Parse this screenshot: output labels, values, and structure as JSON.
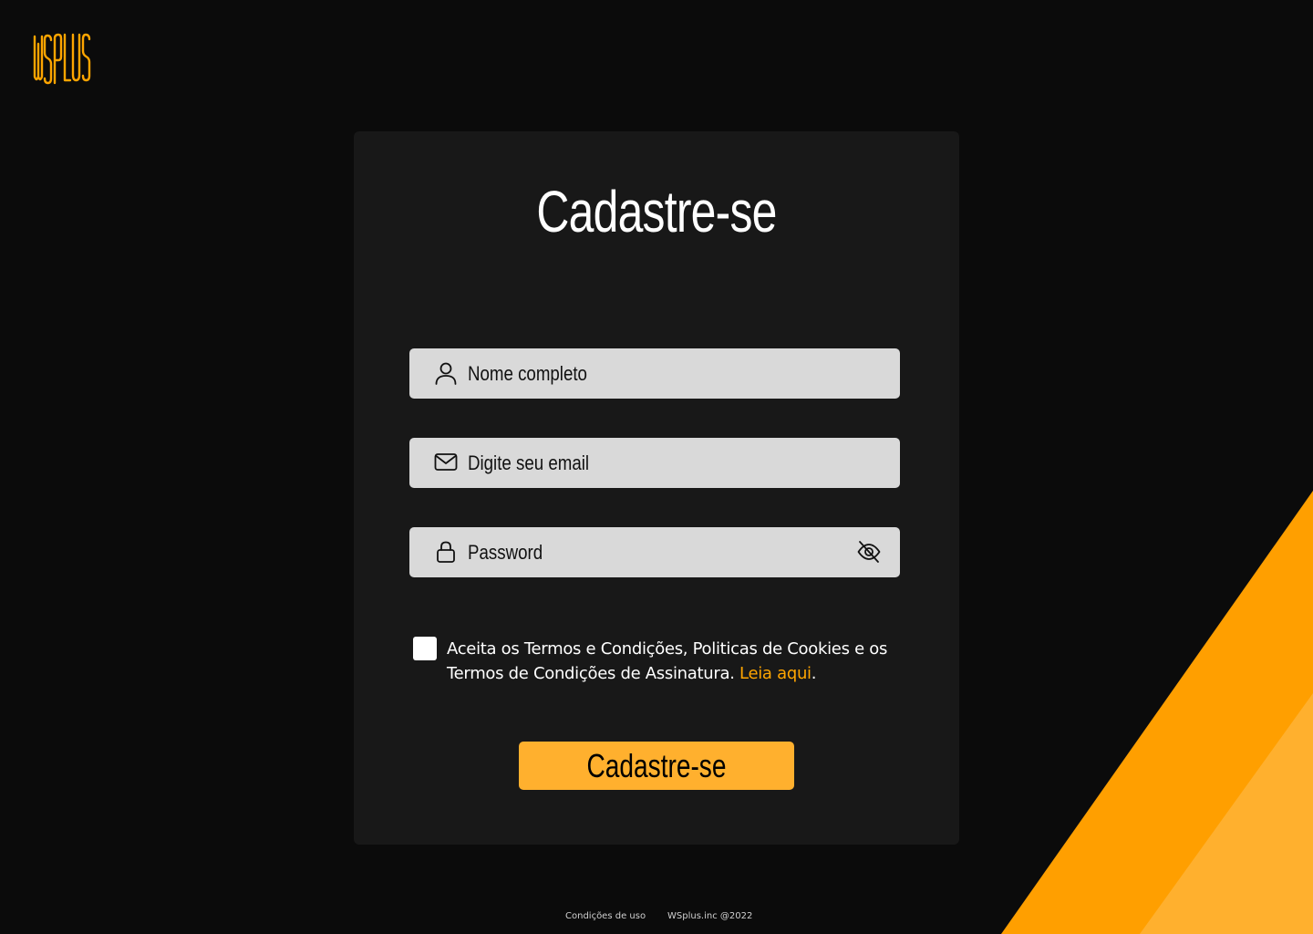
{
  "brand": {
    "logo_text": "WSPLUS",
    "accent_color": "#ffa500",
    "button_color": "#ffb02e",
    "card_color": "#181818",
    "background_color": "#0b0b0b"
  },
  "form": {
    "title": "Cadastre-se",
    "fields": {
      "name": {
        "placeholder": "Nome completo",
        "icon": "user-icon"
      },
      "email": {
        "placeholder": "Digite seu email",
        "icon": "mail-icon"
      },
      "password": {
        "placeholder": "Password",
        "icon": "lock-icon",
        "toggle_icon": "eye-off-icon"
      }
    },
    "terms": {
      "text": "Aceita os Termos e Condições, Politicas de Cookies e os Termos de Condições de Assinatura. ",
      "link_text": "Leia aqui",
      "suffix": ".",
      "checked": false
    },
    "submit_label": "Cadastre-se"
  },
  "footer": {
    "terms_link": "Condições de uso",
    "copyright": "WSplus.inc @2022"
  }
}
